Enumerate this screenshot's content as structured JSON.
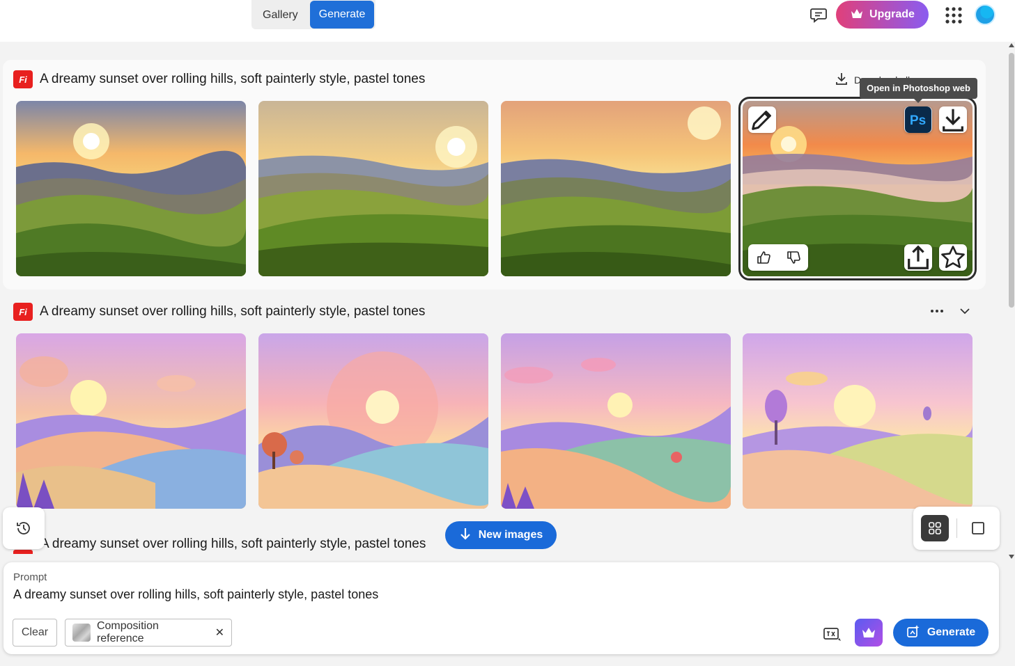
{
  "topbar": {
    "tab_gallery": "Gallery",
    "tab_generate": "Generate",
    "upgrade_label": "Upgrade",
    "active_tab": "Generate"
  },
  "groups": [
    {
      "prompt": "A dreamy sunset over rolling hills, soft painterly style, pastel tones",
      "download_all_label": "Download all"
    },
    {
      "prompt": "A dreamy sunset over rolling hills, soft painterly style, pastel tones"
    },
    {
      "prompt": "A dreamy sunset over rolling hills, soft painterly style, pastel tones"
    }
  ],
  "tooltip": "Open in Photoshop web",
  "new_images_label": "New images",
  "prompt_panel": {
    "label": "Prompt",
    "value": "A dreamy sunset over rolling hills, soft painterly style, pastel tones",
    "clear_label": "Clear",
    "composition_reference_label": "Composition reference",
    "generate_label": "Generate"
  },
  "colors": {
    "accent_blue": "#1a6ad9",
    "firefly_red": "#e8201f",
    "upgrade_gradient_start": "#e0407a",
    "upgrade_gradient_end": "#8a5cf0"
  }
}
